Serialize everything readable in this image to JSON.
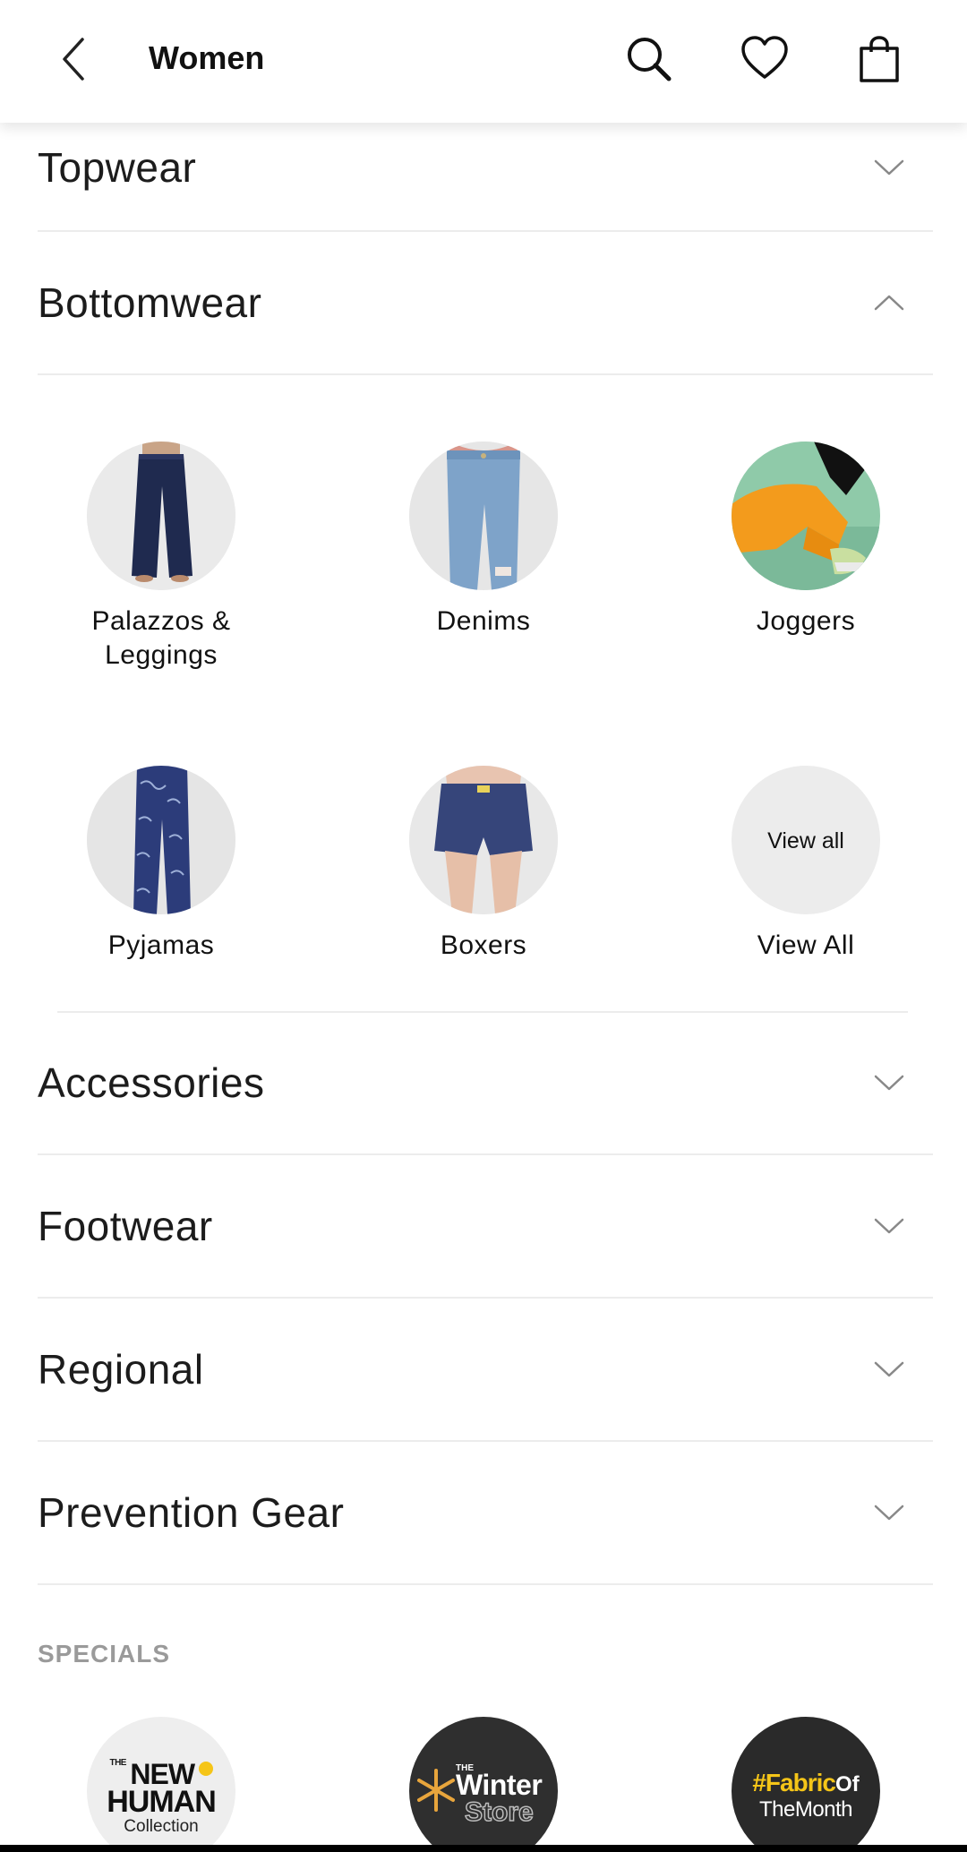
{
  "header": {
    "title": "Women",
    "icons": [
      "back-arrow-icon",
      "search-icon",
      "heart-icon",
      "shopping-bag-icon"
    ]
  },
  "categories_top": [
    {
      "label": "Topwear",
      "expanded": false
    },
    {
      "label": "Bottomwear",
      "expanded": true
    }
  ],
  "bottomwear_items": [
    {
      "name": "Palazzos & Leggings",
      "name_line1": "Palazzos &",
      "name_line2": "Leggings"
    },
    {
      "name": "Denims"
    },
    {
      "name": "Joggers"
    },
    {
      "name": "Pyjamas"
    },
    {
      "name": "Boxers"
    },
    {
      "name": "View All",
      "circle_text": "View all"
    }
  ],
  "categories_bottom": [
    {
      "label": "Accessories",
      "expanded": false
    },
    {
      "label": "Footwear",
      "expanded": false
    },
    {
      "label": "Regional",
      "expanded": false
    },
    {
      "label": "Prevention Gear",
      "expanded": false
    }
  ],
  "specials": {
    "title": "SPECIALS",
    "items": [
      {
        "the": "THE",
        "line1": "NEW",
        "line2": "HUMAN",
        "line3": "Collection"
      },
      {
        "the": "THE",
        "line1": "Winter",
        "line2": "Store"
      },
      {
        "line1": "#Fabric",
        "line1b": "Of",
        "line2": "TheMonth"
      }
    ]
  },
  "colors": {
    "divider": "#ececec",
    "circle_bg": "#ececec",
    "specials_label": "#9a9a9a",
    "winter_orange": "#e8a53c",
    "fabric_yellow": "#f5c518"
  }
}
